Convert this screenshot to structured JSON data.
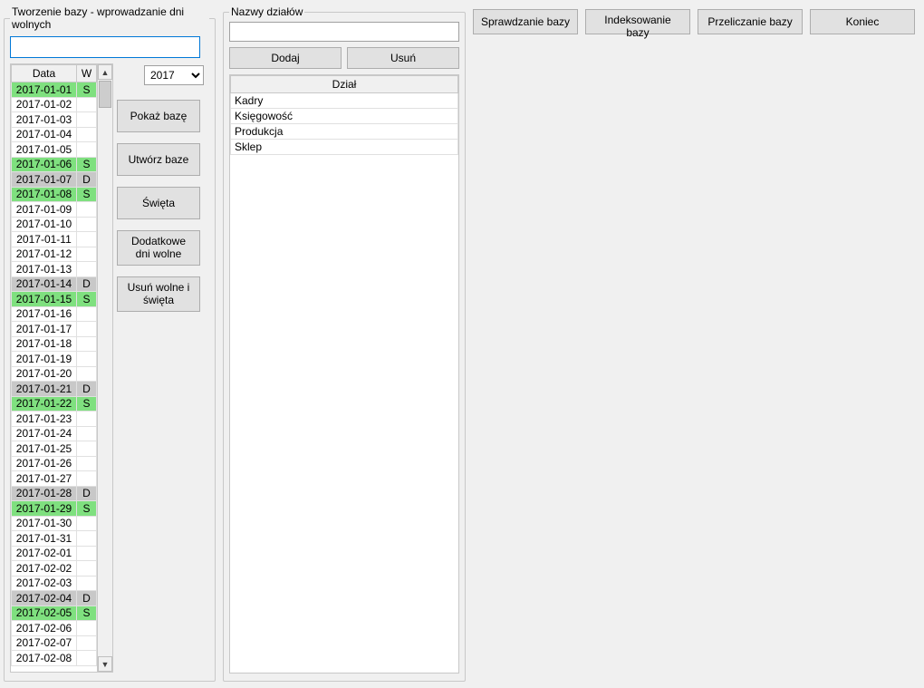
{
  "left_panel": {
    "legend": "Tworzenie bazy - wprowadzanie dni wolnych",
    "input_value": "",
    "year_selected": "2017",
    "year_options": [
      "2017"
    ],
    "table": {
      "col_data": "Data",
      "col_w": "W",
      "rows": [
        {
          "date": "2017-01-01",
          "w": "S",
          "type": "green"
        },
        {
          "date": "2017-01-02",
          "w": "",
          "type": ""
        },
        {
          "date": "2017-01-03",
          "w": "",
          "type": ""
        },
        {
          "date": "2017-01-04",
          "w": "",
          "type": ""
        },
        {
          "date": "2017-01-05",
          "w": "",
          "type": ""
        },
        {
          "date": "2017-01-06",
          "w": "S",
          "type": "green"
        },
        {
          "date": "2017-01-07",
          "w": "D",
          "type": "gray"
        },
        {
          "date": "2017-01-08",
          "w": "S",
          "type": "green"
        },
        {
          "date": "2017-01-09",
          "w": "",
          "type": ""
        },
        {
          "date": "2017-01-10",
          "w": "",
          "type": ""
        },
        {
          "date": "2017-01-11",
          "w": "",
          "type": ""
        },
        {
          "date": "2017-01-12",
          "w": "",
          "type": ""
        },
        {
          "date": "2017-01-13",
          "w": "",
          "type": ""
        },
        {
          "date": "2017-01-14",
          "w": "D",
          "type": "gray"
        },
        {
          "date": "2017-01-15",
          "w": "S",
          "type": "green"
        },
        {
          "date": "2017-01-16",
          "w": "",
          "type": ""
        },
        {
          "date": "2017-01-17",
          "w": "",
          "type": ""
        },
        {
          "date": "2017-01-18",
          "w": "",
          "type": ""
        },
        {
          "date": "2017-01-19",
          "w": "",
          "type": ""
        },
        {
          "date": "2017-01-20",
          "w": "",
          "type": ""
        },
        {
          "date": "2017-01-21",
          "w": "D",
          "type": "gray"
        },
        {
          "date": "2017-01-22",
          "w": "S",
          "type": "green"
        },
        {
          "date": "2017-01-23",
          "w": "",
          "type": ""
        },
        {
          "date": "2017-01-24",
          "w": "",
          "type": ""
        },
        {
          "date": "2017-01-25",
          "w": "",
          "type": ""
        },
        {
          "date": "2017-01-26",
          "w": "",
          "type": ""
        },
        {
          "date": "2017-01-27",
          "w": "",
          "type": ""
        },
        {
          "date": "2017-01-28",
          "w": "D",
          "type": "gray"
        },
        {
          "date": "2017-01-29",
          "w": "S",
          "type": "green"
        },
        {
          "date": "2017-01-30",
          "w": "",
          "type": ""
        },
        {
          "date": "2017-01-31",
          "w": "",
          "type": ""
        },
        {
          "date": "2017-02-01",
          "w": "",
          "type": ""
        },
        {
          "date": "2017-02-02",
          "w": "",
          "type": ""
        },
        {
          "date": "2017-02-03",
          "w": "",
          "type": ""
        },
        {
          "date": "2017-02-04",
          "w": "D",
          "type": "gray"
        },
        {
          "date": "2017-02-05",
          "w": "S",
          "type": "green"
        },
        {
          "date": "2017-02-06",
          "w": "",
          "type": ""
        },
        {
          "date": "2017-02-07",
          "w": "",
          "type": ""
        },
        {
          "date": "2017-02-08",
          "w": "",
          "type": ""
        }
      ]
    },
    "buttons": {
      "show_base": "Pokaż  bazę",
      "create_base": "Utwórz baze",
      "holidays": "Święta",
      "extra_free": "Dodatkowe dni wolne",
      "remove_free": "Usuń wolne i święta"
    }
  },
  "mid_panel": {
    "legend": "Nazwy działów",
    "input_value": "",
    "buttons": {
      "add": "Dodaj",
      "remove": "Usuń"
    },
    "table": {
      "col_dept": "Dział",
      "rows": [
        "Kadry",
        "Księgowość",
        "Produkcja",
        "Sklep"
      ]
    }
  },
  "right_buttons": {
    "check_base": "Sprawdzanie bazy",
    "index_base": "Indeksowanie bazy",
    "recalc_base": "Przeliczanie bazy",
    "end": "Koniec"
  }
}
